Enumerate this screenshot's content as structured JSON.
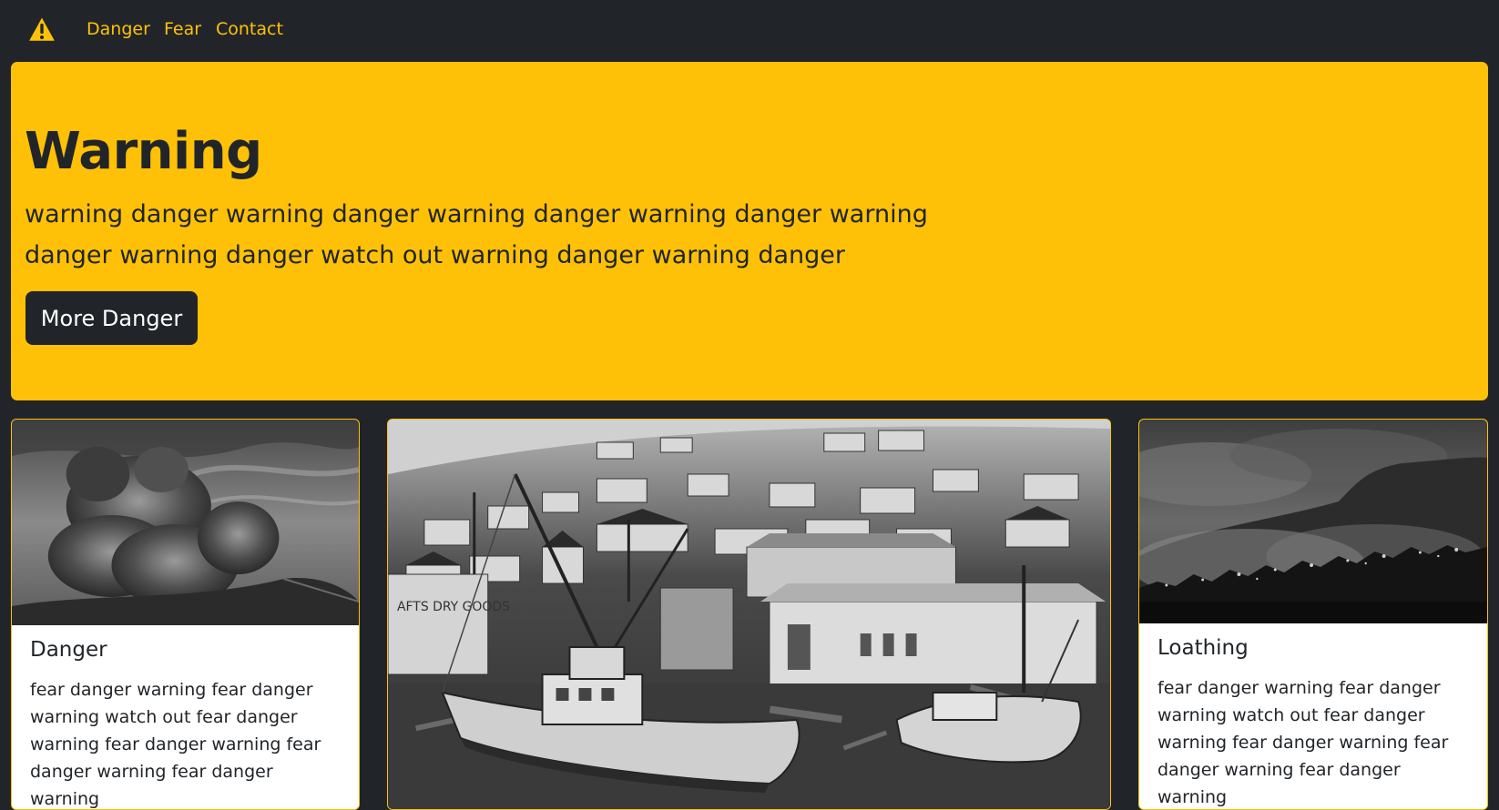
{
  "nav": {
    "logo": "warning-triangle-icon",
    "links": [
      "Danger",
      "Fear",
      "Contact"
    ]
  },
  "hero": {
    "title": "Warning",
    "text": "warning danger warning danger warning danger warning danger warning danger warning danger watch out warning danger warning danger",
    "button": "More Danger"
  },
  "cards": [
    {
      "title": "Danger",
      "text": "fear danger warning fear danger warning watch out fear danger warning fear danger warning fear danger warning fear danger warning",
      "image": "volcano-eruption-photo"
    },
    {
      "title": "",
      "text": "",
      "image": "tsunami-harbor-wreckage-photo"
    },
    {
      "title": "Loathing",
      "text": "fear danger warning fear danger warning watch out fear danger warning fear danger warning fear danger warning fear danger warning",
      "image": "forest-fire-mountain-photo"
    }
  ],
  "colors": {
    "background": "#212529",
    "accent": "#ffc107",
    "card": "#ffffff"
  }
}
